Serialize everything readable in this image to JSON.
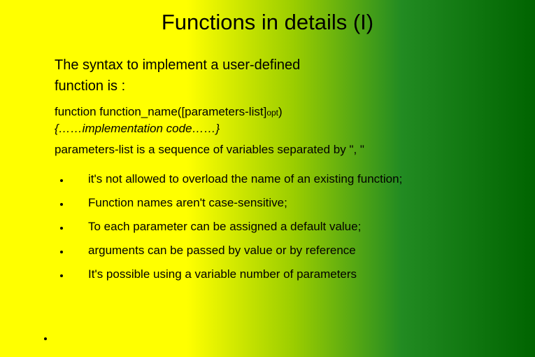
{
  "title": "Functions in details (I)",
  "intro_line1": "The syntax to implement a user-defined",
  "intro_line2": "function is :",
  "syntax_pre": "function function_name([parameters-list]",
  "syntax_opt": "opt",
  "syntax_post": ")",
  "implementation": "{……implementation code……}",
  "note": "parameters-list is a sequence of variables separated by \", \"",
  "bullets": [
    "it's not allowed to overload the name of an existing function;",
    "Function names aren't case-sensitive;",
    "To each parameter can be assigned a default value;",
    "arguments can be passed by value or by reference",
    "It's possible using a variable number of parameters"
  ]
}
